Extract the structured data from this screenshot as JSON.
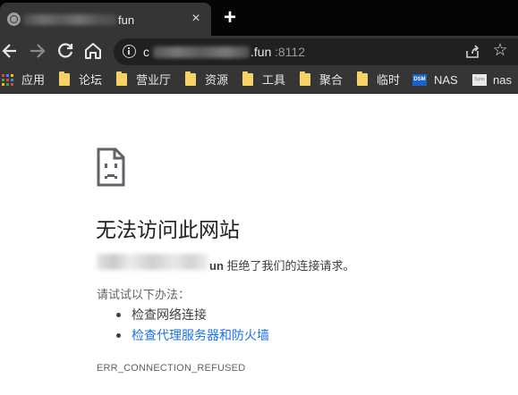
{
  "tab": {
    "title_suffix": "fun",
    "close_glyph": "×",
    "new_tab_glyph": "+"
  },
  "address_bar": {
    "url_prefix": "c",
    "url_host_suffix": ".fun",
    "url_port": ":8112"
  },
  "bookmarks": [
    {
      "label": "应用",
      "icon": "apps-grid-icon"
    },
    {
      "label": "论坛",
      "icon": "folder-icon"
    },
    {
      "label": "营业厅",
      "icon": "folder-icon"
    },
    {
      "label": "资源",
      "icon": "folder-icon"
    },
    {
      "label": "工具",
      "icon": "folder-icon"
    },
    {
      "label": "聚合",
      "icon": "folder-icon"
    },
    {
      "label": "临时",
      "icon": "folder-icon"
    },
    {
      "label": "NAS",
      "icon": "dsm-icon",
      "badge": "DSM"
    },
    {
      "label": "nas",
      "icon": "synology-icon",
      "badge": "Syno"
    }
  ],
  "error_page": {
    "headline": "无法访问此网站",
    "host_suffix": "un",
    "refused_message": "拒绝了我们的连接请求。",
    "try_label": "请试试以下办法：",
    "suggestions": [
      {
        "text": "检查网络连接",
        "is_link": false
      },
      {
        "text": "检查代理服务器和防火墙",
        "is_link": true
      }
    ],
    "error_code": "ERR_CONNECTION_REFUSED"
  },
  "colors": {
    "link": "#1a73e8",
    "folder": "#f5d264",
    "chrome_bg": "#353535",
    "tabstrip_bg": "#050505"
  }
}
